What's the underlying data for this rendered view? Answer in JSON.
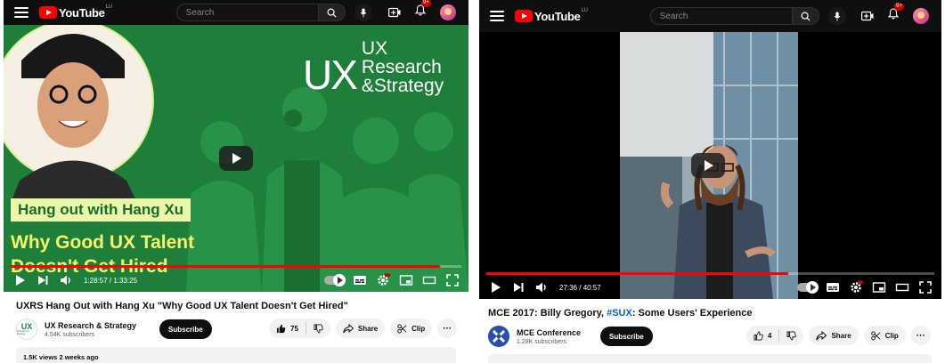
{
  "topbar": {
    "logo_text": "YouTube",
    "logo_region": "LU",
    "search_placeholder": "Search",
    "notifications_badge": "9+"
  },
  "left": {
    "thumbnail": {
      "brand_line1": "UX Research",
      "brand_line2": "&Strategy",
      "banner": "Hang out with Hang Xu",
      "headline_line1": "Why Good UX Talent",
      "headline_line2": "Doesn't Get Hired"
    },
    "player": {
      "time": "1:28:57 / 1:33:25",
      "progress": 0.952
    },
    "video_title": "UXRS Hang Out with Hang Xu \"Why Good UX Talent Doesn't Get Hired\"",
    "channel": {
      "logo_text_1": "UX",
      "logo_text_2": "Research & Strategy",
      "name": "UX Research & Strategy",
      "subscribers": "4.54K subscribers",
      "subscribe_label": "Subscribe"
    },
    "actions": {
      "likes": "75",
      "share_label": "Share",
      "clip_label": "Clip"
    },
    "description_preview": "1.5K views  2 weeks ago"
  },
  "right": {
    "player": {
      "time": "27:36 / 40:57",
      "progress": 0.674
    },
    "video_title_prefix": "MCE 2017: Billy Gregory, ",
    "video_title_hashtag": "#SUX",
    "video_title_suffix": ": Some Users' Experience",
    "channel": {
      "name": "MCE Conference",
      "subscribers": "1.28K subscribers",
      "subscribe_label": "Subscribe"
    },
    "actions": {
      "likes": "4",
      "share_label": "Share",
      "clip_label": "Clip"
    }
  },
  "colors": {
    "youtube_red": "#ff0000",
    "thumb_green": "#1e7f3a",
    "banner_yellow": "#e9f7a6",
    "headline_yellow": "#f3f56b",
    "mce_blue": "#2a4fa8",
    "hashtag_blue": "#065fd4"
  }
}
